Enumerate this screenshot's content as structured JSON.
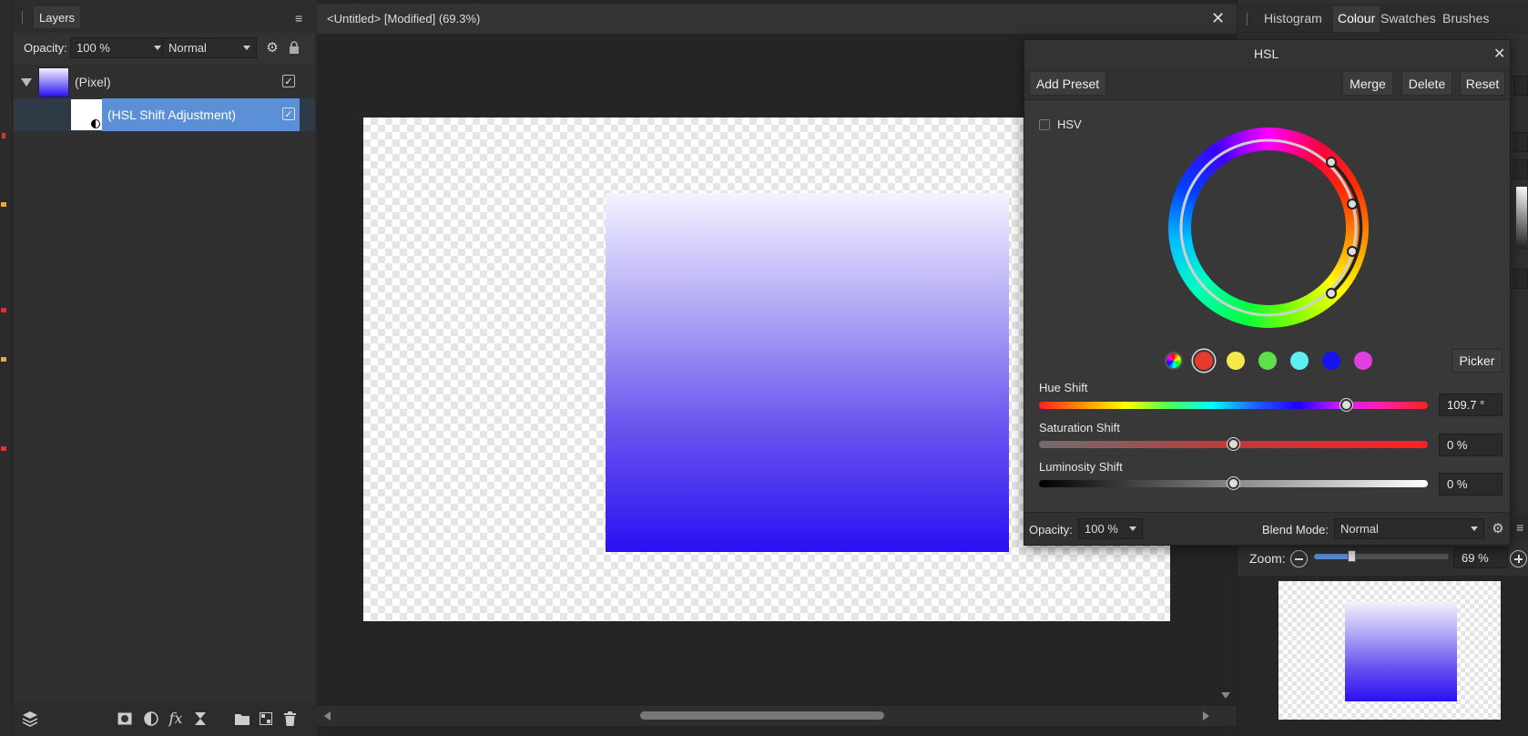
{
  "layers_panel": {
    "tab_label": "Layers",
    "opacity_label": "Opacity:",
    "opacity_value": "100 %",
    "blend_value": "Normal",
    "layers": [
      {
        "name": "(Pixel)",
        "checked": "✓"
      },
      {
        "name": "(HSL Shift Adjustment)",
        "checked": "✓"
      }
    ]
  },
  "document": {
    "tab_title": "<Untitled> [Modified] (69.3%)"
  },
  "right_tabs": [
    "Histogram",
    "Colour",
    "Swatches",
    "Brushes"
  ],
  "hsl_dialog": {
    "title": "HSL",
    "add_preset": "Add Preset",
    "merge": "Merge",
    "delete": "Delete",
    "reset": "Reset",
    "hsv_label": "HSV",
    "picker": "Picker",
    "hue_label": "Hue Shift",
    "hue_value": "109.7 °",
    "hue_level_fraction": 0.79,
    "sat_label": "Saturation Shift",
    "sat_value": "0 %",
    "sat_level_fraction": 0.5,
    "lum_label": "Luminosity Shift",
    "lum_value": "0 %",
    "lum_level_fraction": 0.5,
    "opacity_label": "Opacity:",
    "opacity_value": "100 %",
    "blend_label": "Blend Mode:",
    "blend_value": "Normal",
    "swatch_colors": [
      "#e8392b",
      "#f5e94a",
      "#5ee04a",
      "#5ef0f0",
      "#1414f0",
      "#e040e0"
    ]
  },
  "navigator": {
    "zoom_label": "Zoom:",
    "zoom_value": "69 %",
    "zoom_level_fraction": 0.28
  },
  "colors": {
    "accent": "#5b8fd6",
    "gradient_top": "#f4f2ff",
    "gradient_bottom": "#2a10f2"
  }
}
